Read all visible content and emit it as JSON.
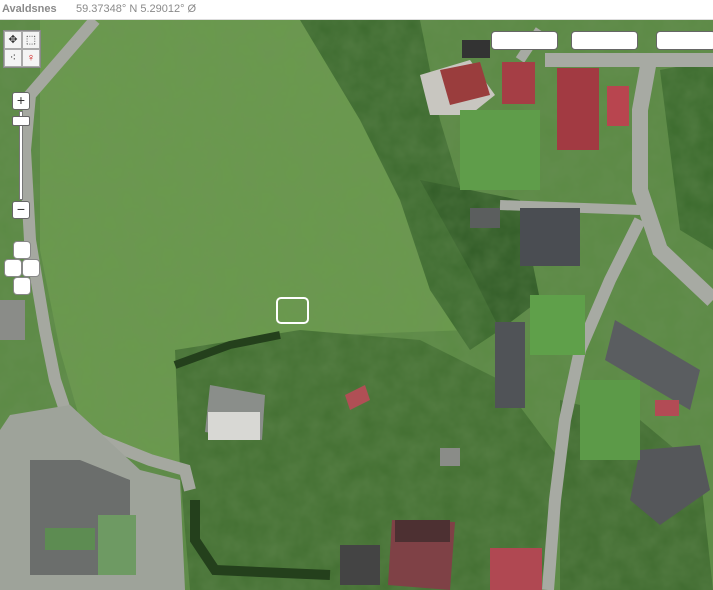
{
  "header": {
    "place_name": "Avaldsnes",
    "coordinates": "59.37348° N  5.29012° Ø"
  },
  "map": {
    "type": "aerial-photo",
    "colors": {
      "field": "#5b8a44",
      "trees": "#2f5a25",
      "road": "#a7aaa3",
      "roof_red": "#9a3d3d",
      "roof_grey": "#4a4d52"
    }
  },
  "tools": {
    "pan_icon": "move-icon",
    "box_icon": "box-select-icon",
    "measure_icon": "measure-icon",
    "pin_icon": "pin-icon"
  },
  "zoom": {
    "in_label": "+",
    "out_label": "−"
  },
  "layers": {
    "buttons": [
      "",
      "",
      ""
    ]
  }
}
